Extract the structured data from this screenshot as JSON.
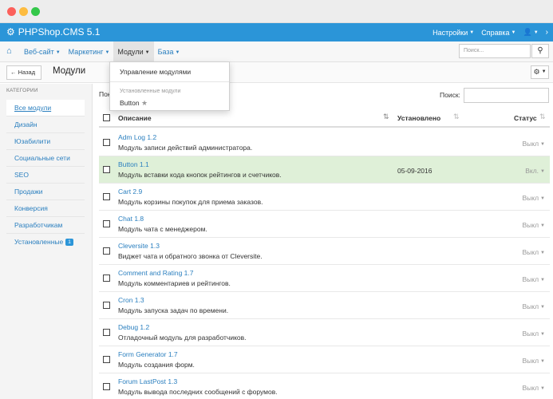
{
  "app": {
    "brand": "PHPShop.CMS 5.1"
  },
  "topmenu": {
    "settings": "Настройки",
    "help": "Справка"
  },
  "nav": {
    "items": [
      {
        "label": "Веб-сайт"
      },
      {
        "label": "Маркетинг"
      },
      {
        "label": "Модули"
      },
      {
        "label": "База"
      }
    ],
    "search_placeholder": "Поиск..."
  },
  "titlebar": {
    "back_label": "Назад",
    "title": "Модули"
  },
  "dropdown": {
    "manage": "Управление модулями",
    "installed_header": "Установленные модули",
    "installed_item": "Button"
  },
  "sidebar": {
    "header": "КАТЕГОРИИ",
    "items": [
      {
        "label": "Все модули"
      },
      {
        "label": "Дизайн"
      },
      {
        "label": "Юзабилити"
      },
      {
        "label": "Социальные сети"
      },
      {
        "label": "SEO"
      },
      {
        "label": "Продажи"
      },
      {
        "label": "Конверсия"
      },
      {
        "label": "Разработчикам"
      },
      {
        "label": "Установленные"
      }
    ],
    "installed_count": "1"
  },
  "content": {
    "show_label": "Пок",
    "search_label": "Поиск:"
  },
  "table": {
    "headers": {
      "description": "Описание",
      "installed": "Установлено",
      "status": "Статус"
    },
    "rows": [
      {
        "name": "Adm Log 1.2",
        "desc": "Модуль записи действий администратора.",
        "date": "",
        "status": "Выкл"
      },
      {
        "name": "Button 1.1",
        "desc": "Модуль вставки кода кнопок рейтингов и счетчиков.",
        "date": "05-09-2016",
        "status": "Вкл."
      },
      {
        "name": "Cart 2.9",
        "desc": "Модуль корзины покупок для приема заказов.",
        "date": "",
        "status": "Выкл"
      },
      {
        "name": "Chat 1.8",
        "desc": "Модуль чата с менеджером.",
        "date": "",
        "status": "Выкл"
      },
      {
        "name": "Cleversite 1.3",
        "desc": "Виджет чата и обратного звонка от Cleversite.",
        "date": "",
        "status": "Выкл"
      },
      {
        "name": "Comment and Rating 1.7",
        "desc": "Модуль комментариев и рейтингов.",
        "date": "",
        "status": "Выкл"
      },
      {
        "name": "Cron 1.3",
        "desc": "Модуль запуска задач по времени.",
        "date": "",
        "status": "Выкл"
      },
      {
        "name": "Debug 1.2",
        "desc": "Отладочный модуль для разработчиков.",
        "date": "",
        "status": "Выкл"
      },
      {
        "name": "Form Generator 1.7",
        "desc": "Модуль создания форм.",
        "date": "",
        "status": "Выкл"
      },
      {
        "name": "Forum LastPost 1.3",
        "desc": "Модуль вывода последних сообщений с форумов.",
        "date": "",
        "status": "Выкл"
      }
    ]
  }
}
